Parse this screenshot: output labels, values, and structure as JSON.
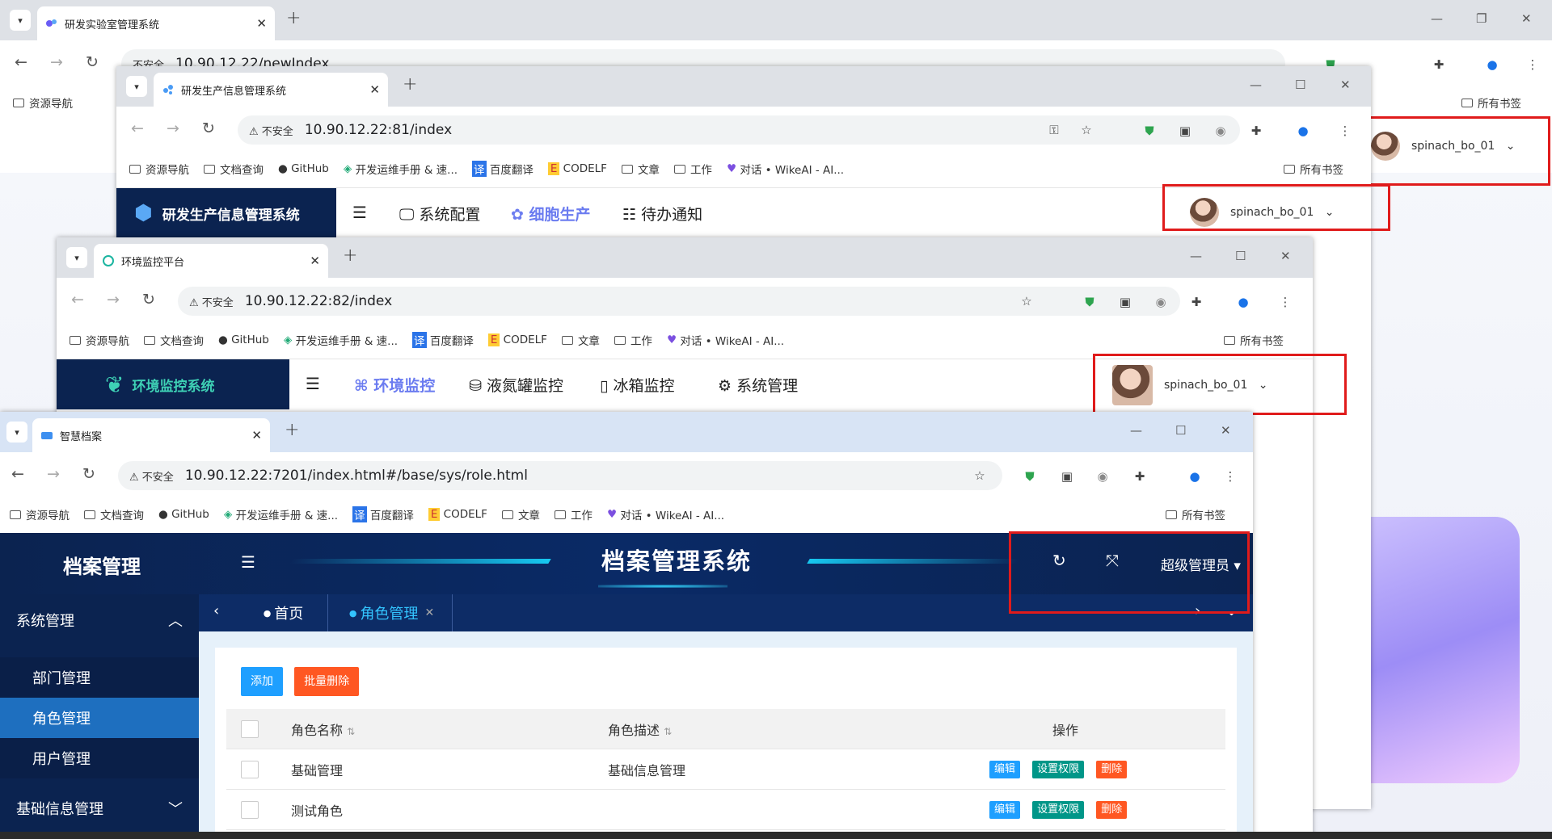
{
  "win1": {
    "tab_title": "研发实验室管理系统",
    "url": "10.90.12.22/newIndex",
    "insecure": "不安全",
    "bookmarks": [
      "资源导航"
    ],
    "all_bookmarks": "所有书签"
  },
  "win2": {
    "tab_title": "研发生产信息管理系统",
    "insecure": "不安全",
    "url": "10.90.12.22:81/index",
    "bookmarks": [
      "资源导航",
      "文档查询",
      "GitHub",
      "开发运维手册 & 速...",
      "百度翻译",
      "CODELF",
      "文章",
      "工作",
      "对话 • WikeAI - AI..."
    ],
    "all_bookmarks": "所有书签",
    "app_title": "研发生产信息管理系统",
    "menu": [
      "系统配置",
      "细胞生产",
      "待办通知"
    ],
    "user": "spinach_bo_01",
    "more_btn": "多"
  },
  "outer_user": "spinach_bo_01",
  "win3": {
    "tab_title": "环境监控平台",
    "insecure": "不安全",
    "url": "10.90.12.22:82/index",
    "bookmarks": [
      "资源导航",
      "文档查询",
      "GitHub",
      "开发运维手册 & 速...",
      "百度翻译",
      "CODELF",
      "文章",
      "工作",
      "对话 • WikeAI - AI..."
    ],
    "all_bookmarks": "所有书签",
    "app_title": "环境监控系统",
    "menu": [
      "环境监控",
      "液氮罐监控",
      "冰箱监控",
      "系统管理"
    ],
    "user": "spinach_bo_01"
  },
  "win4": {
    "tab_title": "智慧档案",
    "insecure": "不安全",
    "url": "10.90.12.22:7201/index.html#/base/sys/role.html",
    "bookmarks": [
      "资源导航",
      "文档查询",
      "GitHub",
      "开发运维手册 & 速...",
      "百度翻译",
      "CODELF",
      "文章",
      "工作",
      "对话 • WikeAI - AI..."
    ],
    "all_bookmarks": "所有书签",
    "logo": "档案管理",
    "banner_title": "档案管理系统",
    "admin": "超级管理员",
    "tabs": [
      "首页",
      "角色管理"
    ],
    "sidebar": {
      "group1": "系统管理",
      "items": [
        "部门管理",
        "角色管理",
        "用户管理"
      ],
      "group2": "基础信息管理"
    },
    "buttons": {
      "add": "添加",
      "batch_delete": "批量删除"
    },
    "table": {
      "headers": [
        "角色名称",
        "角色描述",
        "操作"
      ],
      "rows": [
        {
          "name": "基础管理",
          "desc": "基础信息管理"
        },
        {
          "name": "测试角色",
          "desc": ""
        }
      ],
      "actions": {
        "edit": "编辑",
        "perm": "设置权限",
        "del": "删除"
      }
    }
  },
  "colors": {
    "accent_red": "#e01b1b",
    "navy": "#0b2350",
    "table_blue": "#1e9fff",
    "teal": "#009688",
    "orange": "#ff5722"
  }
}
